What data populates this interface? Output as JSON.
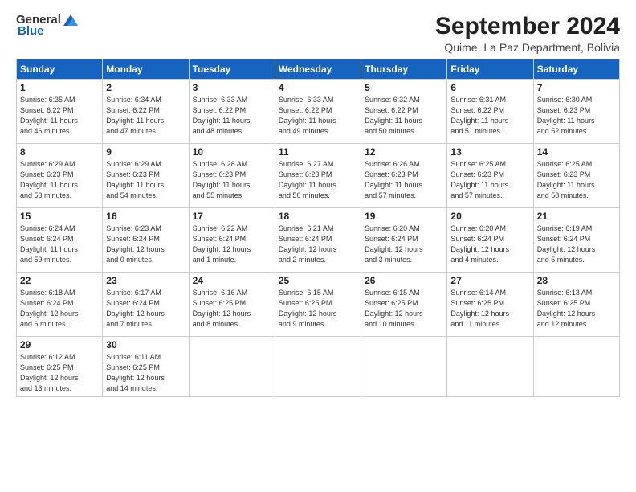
{
  "logo": {
    "general": "General",
    "blue": "Blue"
  },
  "header": {
    "month": "September 2024",
    "location": "Quime, La Paz Department, Bolivia"
  },
  "weekdays": [
    "Sunday",
    "Monday",
    "Tuesday",
    "Wednesday",
    "Thursday",
    "Friday",
    "Saturday"
  ],
  "weeks": [
    [
      {
        "day": "1",
        "info": "Sunrise: 6:35 AM\nSunset: 6:22 PM\nDaylight: 11 hours\nand 46 minutes."
      },
      {
        "day": "2",
        "info": "Sunrise: 6:34 AM\nSunset: 6:22 PM\nDaylight: 11 hours\nand 47 minutes."
      },
      {
        "day": "3",
        "info": "Sunrise: 6:33 AM\nSunset: 6:22 PM\nDaylight: 11 hours\nand 48 minutes."
      },
      {
        "day": "4",
        "info": "Sunrise: 6:33 AM\nSunset: 6:22 PM\nDaylight: 11 hours\nand 49 minutes."
      },
      {
        "day": "5",
        "info": "Sunrise: 6:32 AM\nSunset: 6:22 PM\nDaylight: 11 hours\nand 50 minutes."
      },
      {
        "day": "6",
        "info": "Sunrise: 6:31 AM\nSunset: 6:22 PM\nDaylight: 11 hours\nand 51 minutes."
      },
      {
        "day": "7",
        "info": "Sunrise: 6:30 AM\nSunset: 6:23 PM\nDaylight: 11 hours\nand 52 minutes."
      }
    ],
    [
      {
        "day": "8",
        "info": "Sunrise: 6:29 AM\nSunset: 6:23 PM\nDaylight: 11 hours\nand 53 minutes."
      },
      {
        "day": "9",
        "info": "Sunrise: 6:29 AM\nSunset: 6:23 PM\nDaylight: 11 hours\nand 54 minutes."
      },
      {
        "day": "10",
        "info": "Sunrise: 6:28 AM\nSunset: 6:23 PM\nDaylight: 11 hours\nand 55 minutes."
      },
      {
        "day": "11",
        "info": "Sunrise: 6:27 AM\nSunset: 6:23 PM\nDaylight: 11 hours\nand 56 minutes."
      },
      {
        "day": "12",
        "info": "Sunrise: 6:26 AM\nSunset: 6:23 PM\nDaylight: 11 hours\nand 57 minutes."
      },
      {
        "day": "13",
        "info": "Sunrise: 6:25 AM\nSunset: 6:23 PM\nDaylight: 11 hours\nand 57 minutes."
      },
      {
        "day": "14",
        "info": "Sunrise: 6:25 AM\nSunset: 6:23 PM\nDaylight: 11 hours\nand 58 minutes."
      }
    ],
    [
      {
        "day": "15",
        "info": "Sunrise: 6:24 AM\nSunset: 6:24 PM\nDaylight: 11 hours\nand 59 minutes."
      },
      {
        "day": "16",
        "info": "Sunrise: 6:23 AM\nSunset: 6:24 PM\nDaylight: 12 hours\nand 0 minutes."
      },
      {
        "day": "17",
        "info": "Sunrise: 6:22 AM\nSunset: 6:24 PM\nDaylight: 12 hours\nand 1 minute."
      },
      {
        "day": "18",
        "info": "Sunrise: 6:21 AM\nSunset: 6:24 PM\nDaylight: 12 hours\nand 2 minutes."
      },
      {
        "day": "19",
        "info": "Sunrise: 6:20 AM\nSunset: 6:24 PM\nDaylight: 12 hours\nand 3 minutes."
      },
      {
        "day": "20",
        "info": "Sunrise: 6:20 AM\nSunset: 6:24 PM\nDaylight: 12 hours\nand 4 minutes."
      },
      {
        "day": "21",
        "info": "Sunrise: 6:19 AM\nSunset: 6:24 PM\nDaylight: 12 hours\nand 5 minutes."
      }
    ],
    [
      {
        "day": "22",
        "info": "Sunrise: 6:18 AM\nSunset: 6:24 PM\nDaylight: 12 hours\nand 6 minutes."
      },
      {
        "day": "23",
        "info": "Sunrise: 6:17 AM\nSunset: 6:24 PM\nDaylight: 12 hours\nand 7 minutes."
      },
      {
        "day": "24",
        "info": "Sunrise: 6:16 AM\nSunset: 6:25 PM\nDaylight: 12 hours\nand 8 minutes."
      },
      {
        "day": "25",
        "info": "Sunrise: 6:15 AM\nSunset: 6:25 PM\nDaylight: 12 hours\nand 9 minutes."
      },
      {
        "day": "26",
        "info": "Sunrise: 6:15 AM\nSunset: 6:25 PM\nDaylight: 12 hours\nand 10 minutes."
      },
      {
        "day": "27",
        "info": "Sunrise: 6:14 AM\nSunset: 6:25 PM\nDaylight: 12 hours\nand 11 minutes."
      },
      {
        "day": "28",
        "info": "Sunrise: 6:13 AM\nSunset: 6:25 PM\nDaylight: 12 hours\nand 12 minutes."
      }
    ],
    [
      {
        "day": "29",
        "info": "Sunrise: 6:12 AM\nSunset: 6:25 PM\nDaylight: 12 hours\nand 13 minutes."
      },
      {
        "day": "30",
        "info": "Sunrise: 6:11 AM\nSunset: 6:25 PM\nDaylight: 12 hours\nand 14 minutes."
      },
      {
        "day": "",
        "info": ""
      },
      {
        "day": "",
        "info": ""
      },
      {
        "day": "",
        "info": ""
      },
      {
        "day": "",
        "info": ""
      },
      {
        "day": "",
        "info": ""
      }
    ]
  ]
}
